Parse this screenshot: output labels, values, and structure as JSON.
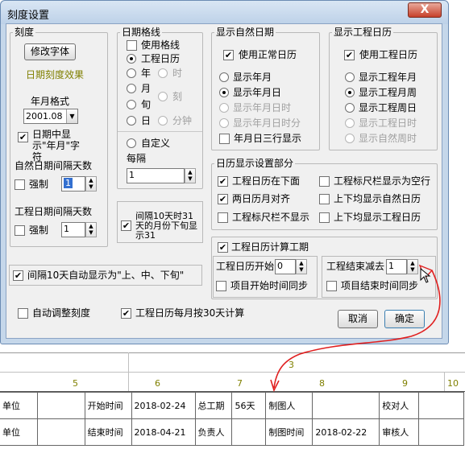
{
  "window": {
    "title": "刻度设置",
    "close_symbol": "X"
  },
  "scale": {
    "title": "刻度",
    "font_button": "修改字体",
    "effect_label": "日期刻度效果",
    "year_format_label": "年月格式",
    "year_format_value": "2001.08",
    "show_year_month": "日期中显示\"年月\"字符",
    "natural_interval_label": "自然日期间隔天数",
    "natural_force": "强制",
    "natural_value": "1",
    "project_interval_label": "工程日期间隔天数",
    "project_force": "强制",
    "project_value": "1"
  },
  "gridlines": {
    "title": "日期格线",
    "use_grid": "使用格线",
    "project_calendar": "工程日历",
    "year": "年",
    "hour": "时",
    "month": "月",
    "quarter": "刻",
    "ten_days": "旬",
    "minute": "分钟",
    "day": "日",
    "custom": "自定义",
    "every": "每隔",
    "every_value": "1",
    "interval_31": "间隔10天时31天的月份下旬显示31"
  },
  "natural_dates": {
    "title": "显示自然日期",
    "use_normal": "使用正常日历",
    "options": [
      "显示年月",
      "显示年月日",
      "显示年月日时",
      "显示年月日时分"
    ],
    "three_rows": "年月日三行显示"
  },
  "project_dates": {
    "title": "显示工程日历",
    "use_project": "使用工程日历",
    "options": [
      "显示工程年月",
      "显示工程月周",
      "显示工程周日",
      "显示工程日时",
      "显示自然周时"
    ]
  },
  "calendar_settings": {
    "title": "日历显示设置部分",
    "project_below": "工程日历在下面",
    "ruler_empty": "工程标尺栏显示为空行",
    "align_two": "两日历月对齐",
    "show_natural": "上下均显示自然日历",
    "ruler_hide": "工程标尺栏不显示",
    "show_project": "上下均显示工程日历"
  },
  "calc": {
    "title": "工程日历计算工期",
    "start_label": "工程日历开始",
    "start_value": "0",
    "end_label": "工程结束减去",
    "end_value": "1",
    "sync_start": "项目开始时间同步",
    "sync_end": "项目结束时间同步"
  },
  "footer": {
    "auto_ten_days": "间隔10天自动显示为\"上、中、下旬\"",
    "auto_adjust": "自动调整刻度",
    "month_30": "工程日历每月按30天计算",
    "cancel": "取消",
    "ok": "确定"
  },
  "timeline": {
    "top_number": "3",
    "ticks": [
      "5",
      "6",
      "7",
      "8",
      "9",
      "10"
    ]
  },
  "sheet": {
    "rows": [
      [
        "单位",
        "",
        "开始时间",
        "2018-02-24",
        "总工期",
        "56天",
        "制图人",
        "",
        "校对人",
        ""
      ],
      [
        "单位",
        "",
        "结束时间",
        "2018-04-21",
        "负责人",
        "",
        "制图时间",
        "2018-02-22",
        "审核人",
        ""
      ]
    ]
  },
  "colors": {
    "accent_text": "#808000",
    "annotation": "#e02020"
  }
}
